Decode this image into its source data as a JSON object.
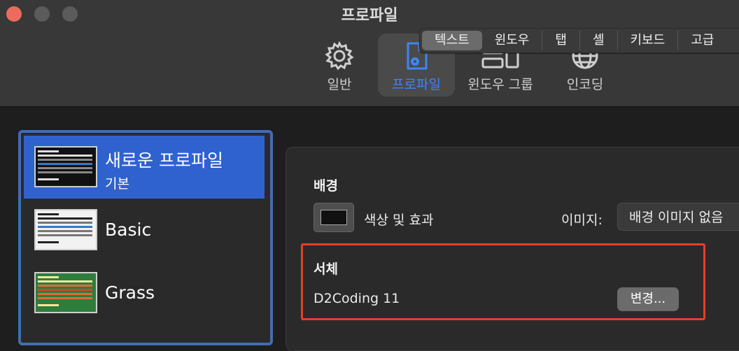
{
  "window": {
    "title": "프로파일"
  },
  "toolbar": {
    "items": [
      {
        "label": "일반",
        "icon": "gear-icon"
      },
      {
        "label": "프로파일",
        "icon": "profile-document-icon",
        "active": true
      },
      {
        "label": "윈도우 그룹",
        "icon": "window-group-icon"
      },
      {
        "label": "인코딩",
        "icon": "globe-icon"
      }
    ]
  },
  "profiles": [
    {
      "name": "새로운 프로파일",
      "subtitle": "기본",
      "selected": true,
      "theme": "dark"
    },
    {
      "name": "Basic",
      "subtitle": "",
      "selected": false,
      "theme": "basic"
    },
    {
      "name": "Grass",
      "subtitle": "",
      "selected": false,
      "theme": "grass"
    }
  ],
  "tabs": [
    "텍스트",
    "윈도우",
    "탭",
    "셸",
    "키보드",
    "고급"
  ],
  "active_tab": "텍스트",
  "background": {
    "title": "배경",
    "color_effect_label": "색상 및 효과",
    "image_label": "이미지:",
    "image_value": "배경 이미지 없음"
  },
  "font": {
    "title": "서체",
    "value": "D2Coding 11",
    "change_button": "변경..."
  },
  "colors": {
    "accent": "#2f62cf",
    "active_toolbar": "#3b87f5",
    "highlight_box": "#e5402a"
  }
}
